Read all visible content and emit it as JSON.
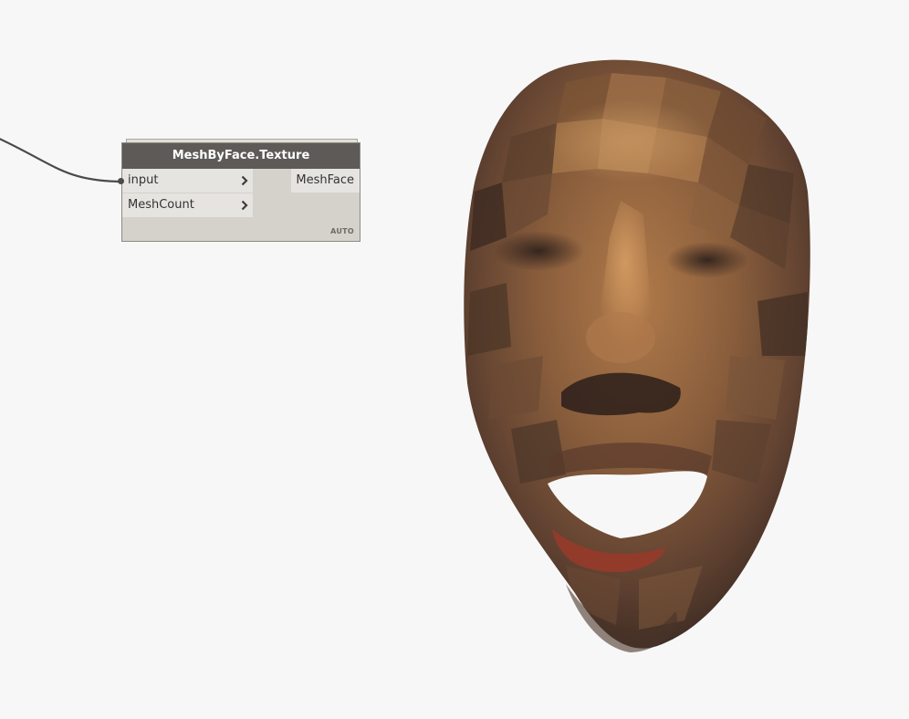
{
  "node": {
    "title": "MeshByFace.Texture",
    "inputs": [
      {
        "label": "input"
      },
      {
        "label": "MeshCount"
      }
    ],
    "outputs": [
      {
        "label": "MeshFace"
      }
    ],
    "lacing": "AUTO"
  },
  "colors": {
    "canvas_bg": "#f7f7f7",
    "node_header": "#5d5a58",
    "node_body": "#d5d1cb",
    "port_bg": "#e6e4e0",
    "wire": "#4a4a4a",
    "skin_base": "#8a6040",
    "skin_highlight": "#c08e5a",
    "skin_shadow": "#3a2a22",
    "lip_red": "#9a3a2a"
  },
  "icons": {
    "port_arrow": "chevron-right-icon"
  },
  "preview": {
    "description_object": "textured face mesh"
  }
}
